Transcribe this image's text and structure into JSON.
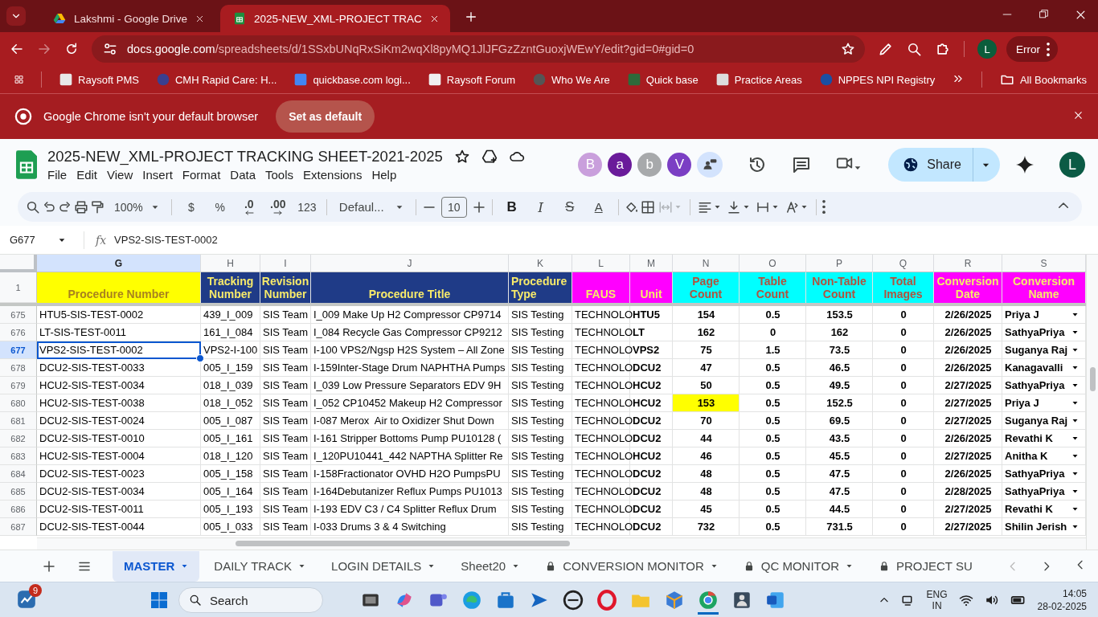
{
  "browser": {
    "tabs": [
      {
        "title": "Lakshmi - Google Drive",
        "selected": false,
        "kind": "drive"
      },
      {
        "title": "2025-NEW_XML-PROJECT TRAC",
        "selected": true,
        "kind": "sheets"
      }
    ],
    "address": {
      "host": "docs.google.com",
      "path": "/spreadsheets/d/1SSxbUNqRxSiKm2wqXl8pyMQ1JlJFGzZzntGuoxjWEwY/edit?gid=0#gid=0"
    },
    "profile_initial": "L",
    "status": "Error",
    "bookmarks": [
      "Raysoft PMS",
      "CMH Rapid Care: H...",
      "quickbase.com logi...",
      "Raysoft Forum",
      "Who We Are",
      "Quick base",
      "Practice Areas",
      "NPPES NPI Registry"
    ],
    "all_bookmarks": "All Bookmarks",
    "infobar": {
      "message": "Google Chrome isn't your default browser",
      "button": "Set as default"
    }
  },
  "sheet": {
    "title": "2025-NEW_XML-PROJECT TRACKING SHEET-2021-2025",
    "menus": [
      "File",
      "Edit",
      "View",
      "Insert",
      "Format",
      "Data",
      "Tools",
      "Extensions",
      "Help"
    ],
    "collaborators": [
      {
        "initial": "B",
        "color": "#c99fdc"
      },
      {
        "initial": "a",
        "color": "#6a1b9a"
      },
      {
        "initial": "b",
        "color": "#a7a9ab"
      },
      {
        "initial": "V",
        "color": "#7b3fc4"
      }
    ],
    "share": "Share",
    "user_initial": "L",
    "toolbar": {
      "zoom": "100%",
      "currency": "$",
      "percent": "%",
      "decrease_decimal": ".0",
      "increase_decimal": ".00",
      "more_formats": "123",
      "font": "Defaul...",
      "font_size": "10",
      "merge_disabled": true,
      "text_styles": [
        {
          "kind": "bold",
          "label": "B"
        },
        {
          "kind": "italic",
          "label": "I"
        },
        {
          "kind": "strikethrough",
          "label": "S"
        },
        {
          "kind": "color",
          "label": "A"
        }
      ]
    },
    "formula_bar": {
      "cell": "G677",
      "fx": "fx",
      "value": "VPS2-SIS-TEST-0002"
    },
    "columns": [
      {
        "letter": "G",
        "selected": true
      },
      {
        "letter": "H",
        "selected": false
      },
      {
        "letter": "I",
        "selected": false
      },
      {
        "letter": "J",
        "selected": false
      },
      {
        "letter": "K",
        "selected": false
      },
      {
        "letter": "L",
        "selected": false
      },
      {
        "letter": "M",
        "selected": false
      },
      {
        "letter": "N",
        "selected": false
      },
      {
        "letter": "O",
        "selected": false
      },
      {
        "letter": "P",
        "selected": false
      },
      {
        "letter": "Q",
        "selected": false
      },
      {
        "letter": "R",
        "selected": false
      },
      {
        "letter": "S",
        "selected": false
      }
    ],
    "header_row": "1",
    "headers": [
      {
        "text": "Procedure Number",
        "color": "#ffff00"
      },
      {
        "text": "Tracking Number",
        "color": "#1f3b87"
      },
      {
        "text": "Revision Number",
        "color": "#1f3b87"
      },
      {
        "text": "Procedure Title",
        "color": "#1f3b87"
      },
      {
        "text": "Procedure Type",
        "color": "#1f3b87"
      },
      {
        "text": "FAUS",
        "color": "#ff00ff"
      },
      {
        "text": "Unit",
        "color": "#ff00ff"
      },
      {
        "text": "Page Count",
        "color": "#00ffff"
      },
      {
        "text": "Table Count",
        "color": "#00ffff"
      },
      {
        "text": "Non-Table Count",
        "color": "#00ffff"
      },
      {
        "text": "Total Images",
        "color": "#00ffff"
      },
      {
        "text": "Conversion Date",
        "color": "#ff00ff"
      },
      {
        "text": "Conversion Name",
        "color": "#ff00ff"
      }
    ],
    "rows": [
      {
        "number": "675",
        "selected": false,
        "page_count_highlighted": false,
        "cells": [
          "HTU5-SIS-TEST-0002",
          "439_I_009",
          "SIS Team",
          "I_009 Make Up H2 Compressor CP9714",
          "SIS Testing",
          "TECHNOLO",
          "HTU5",
          "154",
          "0.5",
          "153.5",
          "0",
          "2/26/2025",
          "Priya J"
        ]
      },
      {
        "number": "676",
        "selected": false,
        "page_count_highlighted": false,
        "cells": [
          "LT-SIS-TEST-0011",
          "161_I_084",
          "SIS Team",
          "I_084 Recycle Gas Compressor CP9212",
          "SIS Testing",
          "TECHNOLO",
          "LT",
          "162",
          "0",
          "162",
          "0",
          "2/26/2025",
          "SathyaPriya"
        ]
      },
      {
        "number": "677",
        "selected": true,
        "page_count_highlighted": false,
        "cells": [
          "VPS2-SIS-TEST-0002",
          "VPS2-I-100",
          "SIS Team",
          "I-100 VPS2/Ngsp H2S System – All Zone",
          "SIS Testing",
          "TECHNOLO",
          "VPS2",
          "75",
          "1.5",
          "73.5",
          "0",
          "2/26/2025",
          "Suganya Raj"
        ]
      },
      {
        "number": "678",
        "selected": false,
        "page_count_highlighted": false,
        "cells": [
          "DCU2-SIS-TEST-0033",
          "005_I_159",
          "SIS Team",
          "I-159Inter-Stage Drum NAPHTHA Pumps",
          "SIS Testing",
          "TECHNOLO",
          "DCU2",
          "47",
          "0.5",
          "46.5",
          "0",
          "2/26/2025",
          "Kanagavalli"
        ]
      },
      {
        "number": "679",
        "selected": false,
        "page_count_highlighted": false,
        "cells": [
          "HCU2-SIS-TEST-0034",
          "018_I_039",
          "SIS Team",
          "I_039 Low Pressure Separators EDV 9H",
          "SIS Testing",
          "TECHNOLO",
          "HCU2",
          "50",
          "0.5",
          "49.5",
          "0",
          "2/27/2025",
          "SathyaPriya"
        ]
      },
      {
        "number": "680",
        "selected": false,
        "page_count_highlighted": true,
        "cells": [
          "HCU2-SIS-TEST-0038",
          "018_I_052",
          "SIS Team",
          "I_052 CP10452 Makeup H2 Compressor",
          "SIS Testing",
          "TECHNOLO",
          "HCU2",
          "153",
          "0.5",
          "152.5",
          "0",
          "2/27/2025",
          "Priya J"
        ]
      },
      {
        "number": "681",
        "selected": false,
        "page_count_highlighted": false,
        "cells": [
          "DCU2-SIS-TEST-0024",
          "005_I_087",
          "SIS Team",
          "I-087 Merox  Air to Oxidizer Shut Down",
          "SIS Testing",
          "TECHNOLO",
          "DCU2",
          "70",
          "0.5",
          "69.5",
          "0",
          "2/27/2025",
          "Suganya Raj"
        ]
      },
      {
        "number": "682",
        "selected": false,
        "page_count_highlighted": false,
        "cells": [
          "DCU2-SIS-TEST-0010",
          "005_I_161",
          "SIS Team",
          "I-161 Stripper Bottoms Pump PU10128 (",
          "SIS Testing",
          "TECHNOLO",
          "DCU2",
          "44",
          "0.5",
          "43.5",
          "0",
          "2/26/2025",
          "Revathi K"
        ]
      },
      {
        "number": "683",
        "selected": false,
        "page_count_highlighted": false,
        "cells": [
          "HCU2-SIS-TEST-0004",
          "018_I_120",
          "SIS Team",
          "I_120PU10441_442 NAPTHA Splitter Re",
          "SIS Testing",
          "TECHNOLO",
          "HCU2",
          "46",
          "0.5",
          "45.5",
          "0",
          "2/27/2025",
          "Anitha K"
        ]
      },
      {
        "number": "684",
        "selected": false,
        "page_count_highlighted": false,
        "cells": [
          "DCU2-SIS-TEST-0023",
          "005_I_158",
          "SIS Team",
          "I-158Fractionator OVHD H2O PumpsPU",
          "SIS Testing",
          "TECHNOLO",
          "DCU2",
          "48",
          "0.5",
          "47.5",
          "0",
          "2/26/2025",
          "SathyaPriya"
        ]
      },
      {
        "number": "685",
        "selected": false,
        "page_count_highlighted": false,
        "cells": [
          "DCU2-SIS-TEST-0034",
          "005_I_164",
          "SIS Team",
          "I-164Debutanizer Reflux Pumps PU1013",
          "SIS Testing",
          "TECHNOLO",
          "DCU2",
          "48",
          "0.5",
          "47.5",
          "0",
          "2/28/2025",
          "SathyaPriya"
        ]
      },
      {
        "number": "686",
        "selected": false,
        "page_count_highlighted": false,
        "cells": [
          "DCU2-SIS-TEST-0011",
          "005_I_193",
          "SIS Team",
          "I-193 EDV C3 / C4 Splitter Reflux Drum",
          "SIS Testing",
          "TECHNOLO",
          "DCU2",
          "45",
          "0.5",
          "44.5",
          "0",
          "2/27/2025",
          "Revathi K"
        ]
      },
      {
        "number": "687",
        "selected": false,
        "page_count_highlighted": false,
        "cells": [
          "DCU2-SIS-TEST-0044",
          "005_I_033",
          "SIS Team",
          "I-033 Drums 3 & 4 Switching",
          "SIS Testing",
          "TECHNOLO",
          "DCU2",
          "732",
          "0.5",
          "731.5",
          "0",
          "2/27/2025",
          "Shilin Jerish"
        ]
      }
    ],
    "tabs": [
      {
        "label": "MASTER",
        "selected": true,
        "locked": false
      },
      {
        "label": "DAILY TRACK",
        "selected": false,
        "locked": false
      },
      {
        "label": "LOGIN DETAILS",
        "selected": false,
        "locked": false
      },
      {
        "label": "Sheet20",
        "selected": false,
        "locked": false
      },
      {
        "label": "CONVERSION MONITOR",
        "selected": false,
        "locked": true
      },
      {
        "label": "QC MONITOR",
        "selected": false,
        "locked": true
      },
      {
        "label": "PROJECT SU",
        "selected": false,
        "locked": true
      }
    ]
  },
  "taskbar": {
    "notification_count": "9",
    "search": "Search",
    "language": "ENG",
    "region": "IN",
    "time": "14:05",
    "date": "28-02-2025"
  }
}
